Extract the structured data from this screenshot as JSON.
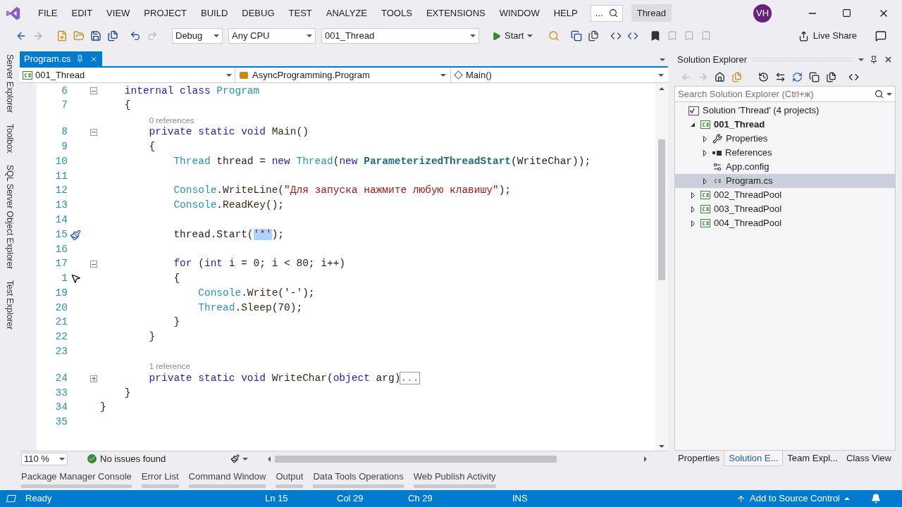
{
  "menu": [
    "FILE",
    "EDIT",
    "VIEW",
    "PROJECT",
    "BUILD",
    "DEBUG",
    "TEST",
    "ANALYZE",
    "TOOLS",
    "EXTENSIONS",
    "WINDOW",
    "HELP"
  ],
  "search": {
    "value": "..."
  },
  "solution_name": "Thread",
  "avatar": "VH",
  "toolbar": {
    "configuration": "Debug",
    "platform": "Any CPU",
    "startup": "001_Thread",
    "start": "Start",
    "live_share": "Live Share"
  },
  "left_rail": [
    "Server Explorer",
    "Toolbox",
    "SQL Server Object Explorer",
    "Test Explorer"
  ],
  "doc_tabs": [
    {
      "label": "Program.cs",
      "selected": true
    }
  ],
  "nav_bar": {
    "project": "001_Thread",
    "type": "AsyncProgramming.Program",
    "member": "Main()"
  },
  "code": [
    {
      "number": "6",
      "expanded": true,
      "segments": [
        {
          "text": "    internal class ",
          "kind": "keyword"
        },
        {
          "text": "Program",
          "kind": "type"
        }
      ]
    },
    {
      "number": "7",
      "segments": [
        {
          "text": "    {",
          "kind": "plain"
        }
      ]
    },
    {
      "number": "8",
      "lens": "0 references",
      "expanded": true,
      "segments": [
        {
          "text": "        private static void ",
          "kind": "keyword"
        },
        {
          "text": "Main",
          "kind": "method"
        },
        {
          "text": "()",
          "kind": "plain"
        }
      ]
    },
    {
      "number": "9",
      "segments": [
        {
          "text": "        {",
          "kind": "plain"
        }
      ]
    },
    {
      "number": "10",
      "segments": [
        {
          "text": "            Thread",
          "kind": "type"
        },
        {
          "text": " thread = ",
          "kind": "plain"
        },
        {
          "text": "new ",
          "kind": "keyword"
        },
        {
          "text": "Thread",
          "kind": "type"
        },
        {
          "text": "(",
          "kind": "plain"
        },
        {
          "text": "new ",
          "kind": "keyword"
        },
        {
          "text": "ParameterizedThreadStart",
          "kind": "delegate"
        },
        {
          "text": "(WriteChar));",
          "kind": "plain"
        }
      ]
    },
    {
      "number": "11"
    },
    {
      "number": "12",
      "segments": [
        {
          "text": "            Console",
          "kind": "type"
        },
        {
          "text": ".",
          "kind": "plain"
        },
        {
          "text": "WriteLine",
          "kind": "method"
        },
        {
          "text": "(",
          "kind": "plain"
        },
        {
          "text": "\"Для запуска нажмите любую клавишу\"",
          "kind": "string"
        },
        {
          "text": ");",
          "kind": "plain"
        }
      ]
    },
    {
      "number": "13",
      "segments": [
        {
          "text": "            Console",
          "kind": "type"
        },
        {
          "text": ".",
          "kind": "plain"
        },
        {
          "text": "ReadKey",
          "kind": "method"
        },
        {
          "text": "();",
          "kind": "plain"
        }
      ]
    },
    {
      "number": "14"
    },
    {
      "number": "15",
      "quick_action": true,
      "segments": [
        {
          "text": "            thread.Start(",
          "kind": "plain"
        },
        {
          "text": "'*'",
          "kind": "selection"
        },
        {
          "text": ");",
          "kind": "plain"
        }
      ]
    },
    {
      "number": "16"
    },
    {
      "number": "17",
      "expanded": true,
      "segments": [
        {
          "text": "            for",
          "kind": "keyword"
        },
        {
          "text": " (",
          "kind": "plain"
        },
        {
          "text": "int",
          "kind": "keyword"
        },
        {
          "text": " i = 0; i < 80; i++)",
          "kind": "plain"
        }
      ]
    },
    {
      "number": "1",
      "pointer": true,
      "segments": [
        {
          "text": "            {",
          "kind": "plain"
        }
      ]
    },
    {
      "number": "19",
      "segments": [
        {
          "text": "                Console",
          "kind": "type"
        },
        {
          "text": ".",
          "kind": "plain"
        },
        {
          "text": "Write",
          "kind": "method"
        },
        {
          "text": "('-');",
          "kind": "plain"
        }
      ]
    },
    {
      "number": "20",
      "segments": [
        {
          "text": "                Thread",
          "kind": "type"
        },
        {
          "text": ".",
          "kind": "plain"
        },
        {
          "text": "Sleep",
          "kind": "method"
        },
        {
          "text": "(70);",
          "kind": "plain"
        }
      ]
    },
    {
      "number": "21",
      "segments": [
        {
          "text": "            }",
          "kind": "plain"
        }
      ]
    },
    {
      "number": "22",
      "segments": [
        {
          "text": "        }",
          "kind": "plain"
        }
      ]
    },
    {
      "number": "23"
    },
    {
      "number": "24",
      "lens": "1 reference",
      "expanded": false,
      "segments": [
        {
          "text": "        private static void ",
          "kind": "keyword"
        },
        {
          "text": "WriteChar",
          "kind": "method"
        },
        {
          "text": "(",
          "kind": "plain"
        },
        {
          "text": "object",
          "kind": "keyword"
        },
        {
          "text": " arg)",
          "kind": "plain"
        },
        {
          "text": "...",
          "kind": "collapsed"
        }
      ]
    },
    {
      "number": "33",
      "segments": [
        {
          "text": "    }",
          "kind": "plain"
        }
      ]
    },
    {
      "number": "34",
      "segments": [
        {
          "text": "}",
          "kind": "plain"
        }
      ]
    },
    {
      "number": "35"
    }
  ],
  "editor_footer": {
    "zoom": "110 %",
    "issues": "No issues found"
  },
  "solution_explorer": {
    "title": "Solution Explorer",
    "search_placeholder": "Search Solution Explorer (Ctrl+ж)",
    "tree": [
      {
        "label": "Solution 'Thread' (4 projects)",
        "kind": "solution",
        "selected": false,
        "children": [
          {
            "label": "001_Thread",
            "kind": "project",
            "startup": true,
            "expanded": true,
            "selected": false,
            "children": [
              {
                "label": "Properties",
                "kind": "properties",
                "expanded": false,
                "selected": false
              },
              {
                "label": "References",
                "kind": "references",
                "expanded": false,
                "selected": false
              },
              {
                "label": "App.config",
                "kind": "config",
                "selected": false
              },
              {
                "label": "Program.cs",
                "kind": "csfile",
                "expanded": false,
                "selected": true
              }
            ]
          },
          {
            "label": "002_ThreadPool",
            "kind": "project",
            "startup": false,
            "expanded": false,
            "selected": false
          },
          {
            "label": "003_ThreadPool",
            "kind": "project",
            "startup": false,
            "expanded": false,
            "selected": false
          },
          {
            "label": "004_ThreadPool",
            "kind": "project",
            "startup": false,
            "expanded": false,
            "selected": false
          }
        ]
      }
    ],
    "tabs": [
      {
        "label": "Properties",
        "selected": false
      },
      {
        "label": "Solution E...",
        "selected": true
      },
      {
        "label": "Team Expl...",
        "selected": false
      },
      {
        "label": "Class View",
        "selected": false
      }
    ]
  },
  "tool_tabs": [
    "Package Manager Console",
    "Error List",
    "Command Window",
    "Output",
    "Data Tools Operations",
    "Web Publish Activity"
  ],
  "status_bar": {
    "state": "Ready",
    "ln": "Ln 15",
    "col": "Col 29",
    "ch": "Ch 29",
    "mode": "INS",
    "source_control": "Add to Source Control"
  }
}
